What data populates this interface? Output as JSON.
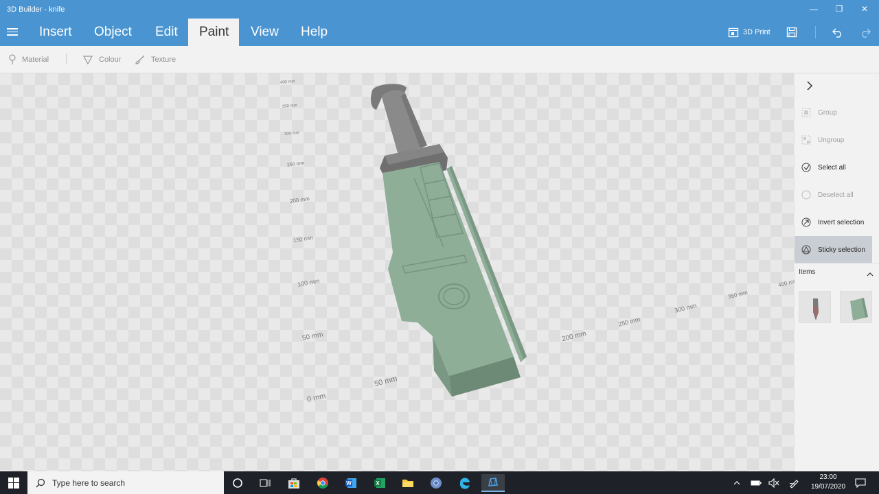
{
  "window": {
    "title": "3D Builder - knife",
    "minimize_glyph": "—",
    "maximize_glyph": "❐",
    "close_glyph": "✕"
  },
  "menu": {
    "tabs": [
      {
        "label": "Insert",
        "active": false
      },
      {
        "label": "Object",
        "active": false
      },
      {
        "label": "Edit",
        "active": false
      },
      {
        "label": "Paint",
        "active": true
      },
      {
        "label": "View",
        "active": false
      },
      {
        "label": "Help",
        "active": false
      }
    ],
    "print_label": "3D Print"
  },
  "toolbar": {
    "material_label": "Material",
    "colour_label": "Colour",
    "texture_label": "Texture"
  },
  "viewport": {
    "ruler_labels": [
      "400 mm",
      "350 mm",
      "300 mm",
      "250 mm",
      "200 mm",
      "150 mm",
      "100 mm",
      "50 mm",
      "0 mm",
      "50 mm",
      "200 mm",
      "250 mm",
      "300 mm",
      "350 mm",
      "400 mm"
    ],
    "model_colors": {
      "handle": "#8a8a8a",
      "handle_dark": "#6f6f6f",
      "blade": "#8fae98",
      "blade_dark": "#7a9884",
      "blade_edge": "#6d8a76"
    }
  },
  "sidepanel": {
    "items": [
      {
        "label": "Group",
        "state": "disabled",
        "icon": "group-icon"
      },
      {
        "label": "Ungroup",
        "state": "disabled",
        "icon": "ungroup-icon"
      },
      {
        "label": "Select all",
        "state": "enabled",
        "icon": "select-all-icon"
      },
      {
        "label": "Deselect all",
        "state": "disabled",
        "icon": "deselect-all-icon"
      },
      {
        "label": "Invert selection",
        "state": "enabled",
        "icon": "invert-selection-icon"
      },
      {
        "label": "Sticky selection",
        "state": "active",
        "icon": "sticky-selection-icon"
      }
    ],
    "items_heading": "Items"
  },
  "taskbar": {
    "search_placeholder": "Type here to search",
    "time": "23:00",
    "date": "19/07/2020"
  },
  "colors": {
    "titlebar": "#4a95d1",
    "taskbar": "#1e2228",
    "active_panel": "#c9ced4"
  }
}
